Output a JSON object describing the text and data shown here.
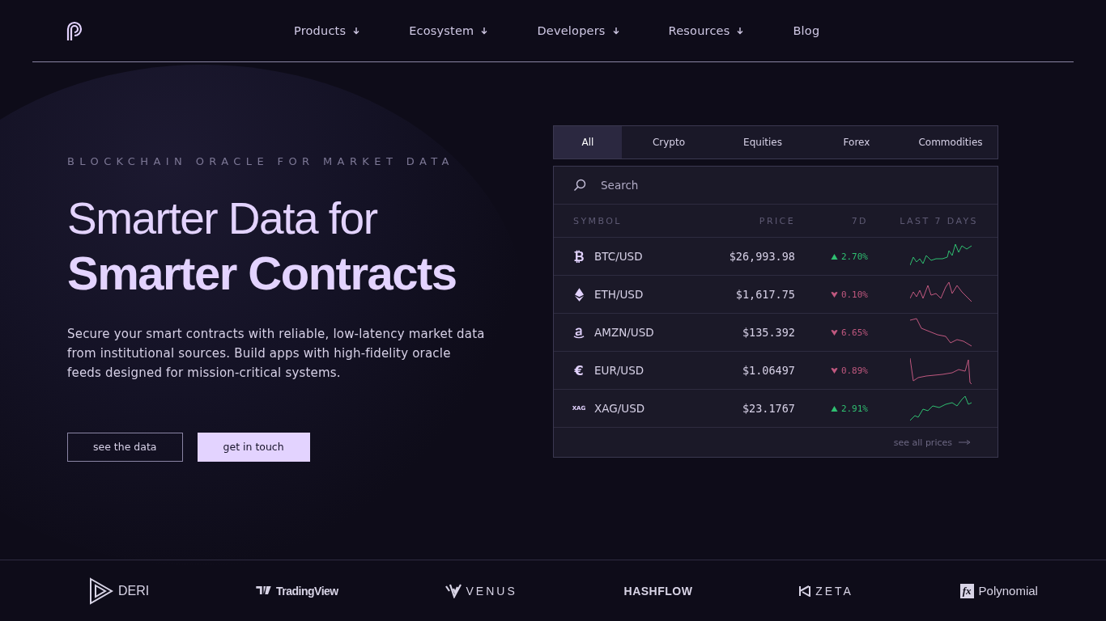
{
  "nav": {
    "items": [
      {
        "label": "Products",
        "dropdown": true
      },
      {
        "label": "Ecosystem",
        "dropdown": true
      },
      {
        "label": "Developers",
        "dropdown": true
      },
      {
        "label": "Resources",
        "dropdown": true
      },
      {
        "label": "Blog",
        "dropdown": false
      }
    ]
  },
  "hero": {
    "eyebrow": "BLOCKCHAIN ORACLE FOR MARKET DATA",
    "title_light": "Smarter Data for",
    "title_bold": "Smarter Contracts",
    "description": "Secure your smart contracts with reliable, low-latency market data from institutional sources. Build apps with high-fidelity oracle feeds designed for mission-critical systems.",
    "buttons": [
      {
        "label": "see the data",
        "kind": "outline"
      },
      {
        "label": "get in touch",
        "kind": "filled"
      }
    ]
  },
  "prices": {
    "tabs": [
      {
        "label": "All",
        "selected": true
      },
      {
        "label": "Crypto",
        "selected": false
      },
      {
        "label": "Equities",
        "selected": false
      },
      {
        "label": "Forex",
        "selected": false
      },
      {
        "label": "Commodities",
        "selected": false
      }
    ],
    "search": {
      "placeholder": "Search"
    },
    "columns": [
      "SYMBOL",
      "PRICE",
      "7D",
      "LAST 7 DAYS"
    ],
    "rows": [
      {
        "icon": {
          "kind": "glyph",
          "text": "₿"
        },
        "symbol": "BTC/USD",
        "price": "$26,993.98",
        "change": "2.70%",
        "rising": true
      },
      {
        "icon": {
          "kind": "eth"
        },
        "symbol": "ETH/USD",
        "price": "$1,617.75",
        "change": "0.10%",
        "rising": false
      },
      {
        "icon": {
          "kind": "amazon"
        },
        "symbol": "AMZN/USD",
        "price": "$135.392",
        "change": "6.65%",
        "rising": false
      },
      {
        "icon": {
          "kind": "glyph",
          "text": "€"
        },
        "symbol": "EUR/USD",
        "price": "$1.06497",
        "change": "0.89%",
        "rising": false
      },
      {
        "icon": {
          "kind": "tag",
          "text": "XAG"
        },
        "symbol": "XAG/USD",
        "price": "$23.1767",
        "change": "2.91%",
        "rising": true
      }
    ],
    "see_all": "see all prices"
  },
  "partners": [
    {
      "name": "DERI",
      "kind": "deri"
    },
    {
      "name": "TradingView",
      "kind": "tv"
    },
    {
      "name": "VENUS",
      "kind": "venus"
    },
    {
      "name": "HASHFLOW",
      "kind": "plain"
    },
    {
      "name": "ZETA",
      "kind": "zeta"
    },
    {
      "name": "Polynomial",
      "kind": "badge",
      "badge": "fx"
    }
  ]
}
